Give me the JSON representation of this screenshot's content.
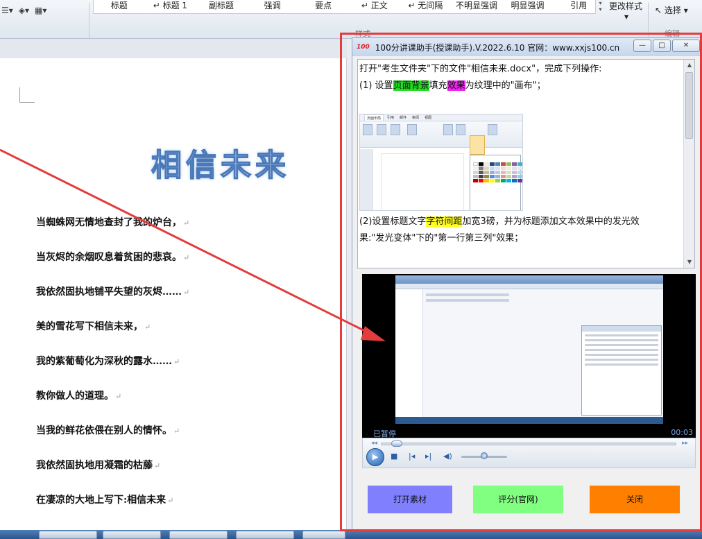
{
  "ribbon": {
    "styles": [
      "标题",
      "↵ 标题 1",
      "副标题",
      "强调",
      "要点",
      "↵ 正文",
      "↵ 无间隔",
      "不明显强调",
      "明显强调",
      "引用"
    ],
    "change_styles": "更改样式",
    "select": "选择",
    "group_styles": "样式",
    "group_editing": "编辑"
  },
  "document": {
    "title": "相信未来",
    "lines": [
      "当蜘蛛网无情地查封了我的炉台，",
      "当灰烬的余烟叹息着贫困的悲哀。",
      "我依然固执地铺平失望的灰烬……",
      "美的雪花写下相信未来，",
      "我的紫葡萄化为深秋的露水……",
      "教你做人的道理。",
      "当我的鲜花依偎在别人的情怀。",
      "我依然固执地用凝霜的枯藤",
      "在凄凉的大地上写下:相信未来"
    ],
    "para_mark": "↵"
  },
  "assistant": {
    "logo": "100",
    "title": "100分讲课助手(授课助手).V.2022.6.10  官网：www.xxjs100.cn",
    "window_buttons": {
      "minimize": "—",
      "maximize": "□",
      "close": "✕"
    },
    "question": {
      "intro": "打开\"考生文件夹\"下的文件\"相信未来.docx\"，完成下列操作:",
      "item1_a": " (1)  设置",
      "item1_hl1": "页面背景",
      "item1_b": "填充",
      "item1_hl2": "效果",
      "item1_c": "为纹理中的\"画布\"；",
      "item2_a": " (2)设置标题文字",
      "item2_hl": "字符间距",
      "item2_b": "加宽3磅，并为标题添加文本效果中的发光效",
      "item2_c": "果:\"发光变体\"下的\"第一行第三列\"效果；"
    },
    "mini_tabs": [
      "页面布局",
      "引用",
      "邮件",
      "审阅",
      "视图"
    ],
    "video": {
      "status": "已暂停",
      "time": "00:03",
      "progress_percent": 4,
      "volume_percent": 50
    },
    "buttons": {
      "open": "打开素材",
      "score": "评分(官网)",
      "close": "关闭"
    },
    "colors": {
      "open": "#8080ff",
      "score": "#80ff80",
      "close": "#ff8000",
      "frame": "#e33c3c"
    }
  }
}
